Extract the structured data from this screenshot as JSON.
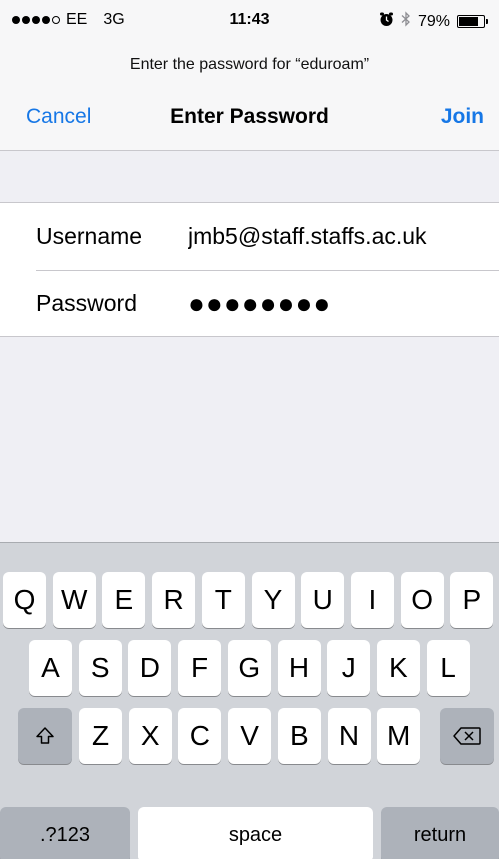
{
  "status_bar": {
    "carrier": "EE",
    "network": "3G",
    "time": "11:43",
    "battery_percent": "79%",
    "battery_level": 0.79,
    "icons": [
      "signal-icon",
      "alarm-icon",
      "bluetooth-icon",
      "battery-icon"
    ]
  },
  "dialog": {
    "prompt": "Enter the password for “eduroam”",
    "title": "Enter Password",
    "cancel_label": "Cancel",
    "join_label": "Join"
  },
  "form": {
    "username_label": "Username",
    "username_value": "jmb5@staff.staffs.ac.uk",
    "password_label": "Password",
    "password_value": "●●●●●●●●"
  },
  "keyboard": {
    "row1": [
      "Q",
      "W",
      "E",
      "R",
      "T",
      "Y",
      "U",
      "I",
      "O",
      "P"
    ],
    "row2": [
      "A",
      "S",
      "D",
      "F",
      "G",
      "H",
      "J",
      "K",
      "L"
    ],
    "row3": [
      "Z",
      "X",
      "C",
      "V",
      "B",
      "N",
      "M"
    ],
    "numbers_label": ".?123",
    "space_label": "space",
    "return_label": "return",
    "shift_icon": "shift-icon",
    "delete_icon": "backspace-icon"
  },
  "colors": {
    "accent": "#1677e6",
    "keyboard_bg": "#d1d4d9",
    "special_key": "#adb2ba"
  }
}
